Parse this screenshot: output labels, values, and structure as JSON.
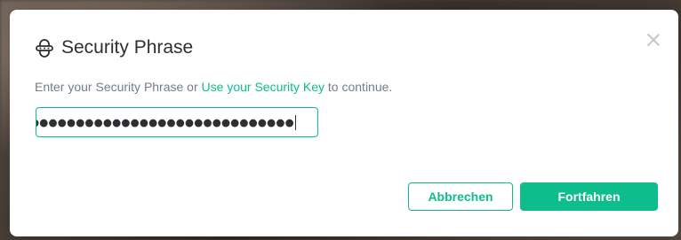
{
  "dialog": {
    "title": "Security Phrase",
    "title_icon": "secure-backup-icon",
    "close_icon": "close-icon",
    "description_prefix": "Enter your Security Phrase or ",
    "description_link": "Use your Security Key",
    "description_suffix": " to continue.",
    "passphrase_masked": "◗●●●●●●●●●●●●●●●●●●●●●●●●●●●●",
    "cancel_label": "Abbrechen",
    "continue_label": "Fortfahren"
  },
  "colors": {
    "accent": "#0dbd8b",
    "text": "#2e2f32",
    "muted": "#737d8c"
  }
}
